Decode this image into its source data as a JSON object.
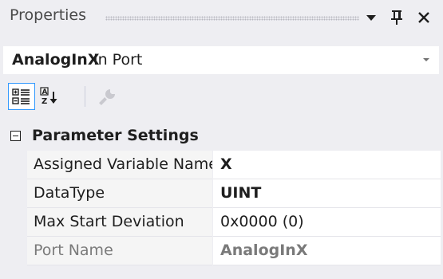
{
  "panel": {
    "title": "Properties"
  },
  "title_buttons": {
    "dropdown_icon": "dropdown-arrow-icon",
    "pin_icon": "pin-icon",
    "close_icon": "close-icon"
  },
  "object_selector": {
    "name": "AnalogInX",
    "type": "In Port"
  },
  "toolbar": {
    "buttons": [
      {
        "icon": "categorized-icon",
        "selected": true
      },
      {
        "icon": "alphabetical-sort-icon",
        "selected": false
      },
      {
        "icon": "property-pages-icon",
        "selected": false,
        "disabled": true
      }
    ]
  },
  "grid": {
    "category": "Parameter Settings",
    "properties": [
      {
        "name": "Assigned Variable Name",
        "value": "X",
        "bold": true,
        "readonly": false
      },
      {
        "name": "DataType",
        "value": "UINT",
        "bold": true,
        "readonly": false
      },
      {
        "name": "Max Start Deviation",
        "value": "0x0000 (0)",
        "bold": false,
        "readonly": false
      },
      {
        "name": "Port Name",
        "value": "AnalogInX",
        "bold": true,
        "readonly": true
      }
    ]
  },
  "colors": {
    "background": "#eeeef2",
    "selection_border": "#3399ff",
    "readonly_text": "#7a7a7a"
  }
}
